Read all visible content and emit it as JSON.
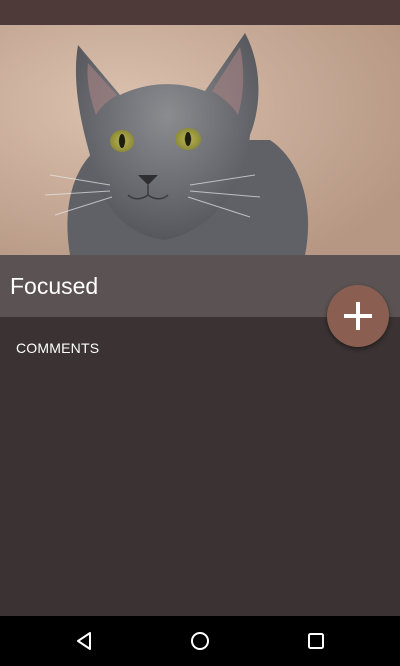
{
  "header": {
    "title": "Focused"
  },
  "hero_image": {
    "subject": "gray cat sitting on beige carpet"
  },
  "fab": {
    "icon": "plus-icon",
    "color": "#8a5f52"
  },
  "comments": {
    "section_label": "COMMENTS",
    "items": []
  },
  "navigation": {
    "back_icon": "back-icon",
    "home_icon": "home-icon",
    "recents_icon": "recents-icon"
  },
  "colors": {
    "status_bar": "#4e3a38",
    "title_bar": "#5a5253",
    "background": "#3a3233",
    "nav_bar": "#000000"
  }
}
